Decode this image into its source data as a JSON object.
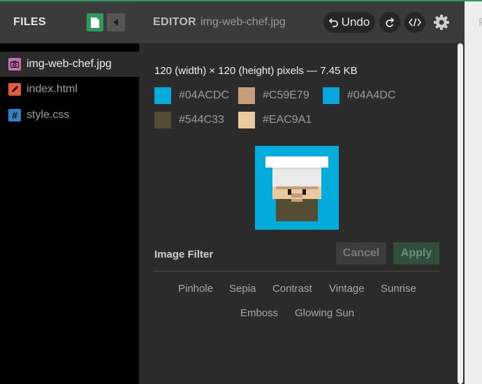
{
  "files_panel": {
    "title": "FILES",
    "items": [
      {
        "label": "img-web-chef.jpg",
        "icon": "camera-icon",
        "active": true
      },
      {
        "label": "index.html",
        "icon": "pencil-icon",
        "active": false
      },
      {
        "label": "style.css",
        "icon": "hash-icon",
        "active": false
      }
    ]
  },
  "editor": {
    "title": "EDITOR",
    "filename": "img-web-chef.jpg",
    "undo_label": "Undo"
  },
  "image_info": {
    "dimensions": "120 (width) × 120 (height) pixels — 7.45 KB",
    "palette": [
      "#04ACDC",
      "#C59E79",
      "#04A4DC",
      "#544C33",
      "#EAC9A1"
    ]
  },
  "filter": {
    "title": "Image Filter",
    "cancel_label": "Cancel",
    "apply_label": "Apply",
    "options": [
      "Pinhole",
      "Sepia",
      "Contrast",
      "Vintage",
      "Sunrise",
      "Emboss",
      "Glowing Sun"
    ]
  },
  "colors": {
    "accent_green": "#2e9a5b",
    "sidebar_bg": "#000000",
    "panel_bg": "#2b2b2b"
  }
}
